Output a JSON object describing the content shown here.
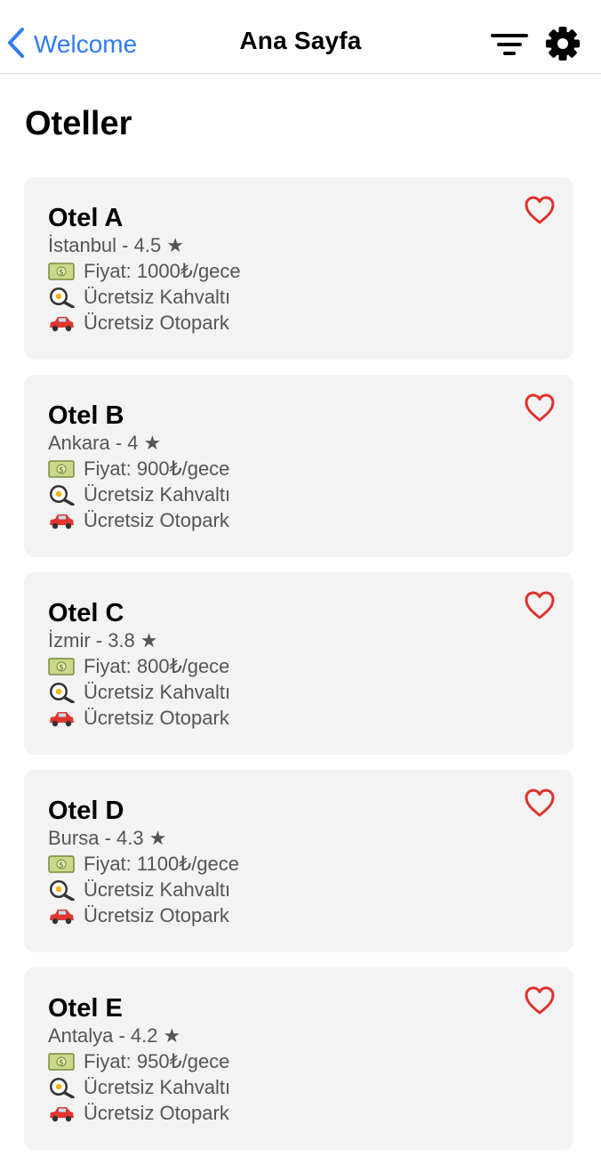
{
  "nav": {
    "back_label": "Welcome",
    "title": "Ana Sayfa"
  },
  "section_title": "Oteller",
  "hotels": [
    {
      "name": "Otel A",
      "location": "İstanbul - 4.5",
      "price": "Fiyat: 1000₺/gece",
      "breakfast": "Ücretsiz Kahvaltı",
      "parking": "Ücretsiz Otopark"
    },
    {
      "name": "Otel B",
      "location": "Ankara - 4",
      "price": "Fiyat: 900₺/gece",
      "breakfast": "Ücretsiz Kahvaltı",
      "parking": "Ücretsiz Otopark"
    },
    {
      "name": "Otel C",
      "location": "İzmir - 3.8",
      "price": "Fiyat: 800₺/gece",
      "breakfast": "Ücretsiz Kahvaltı",
      "parking": "Ücretsiz Otopark"
    },
    {
      "name": "Otel D",
      "location": "Bursa - 4.3",
      "price": "Fiyat: 1100₺/gece",
      "breakfast": "Ücretsiz Kahvaltı",
      "parking": "Ücretsiz Otopark"
    },
    {
      "name": "Otel E",
      "location": "Antalya - 4.2",
      "price": "Fiyat: 950₺/gece",
      "breakfast": "Ücretsiz Kahvaltı",
      "parking": "Ücretsiz Otopark"
    }
  ],
  "icons": {
    "back": "chevron-left-icon",
    "filter": "filter-icon",
    "settings": "gear-icon",
    "favorite": "heart-outline-icon",
    "price": "money-icon",
    "breakfast": "frying-pan-icon",
    "parking": "car-icon",
    "rating": "star-icon"
  },
  "colors": {
    "accent": "#2f7cf6",
    "heart": "#e0312b",
    "card_bg": "#f3f3f3"
  }
}
